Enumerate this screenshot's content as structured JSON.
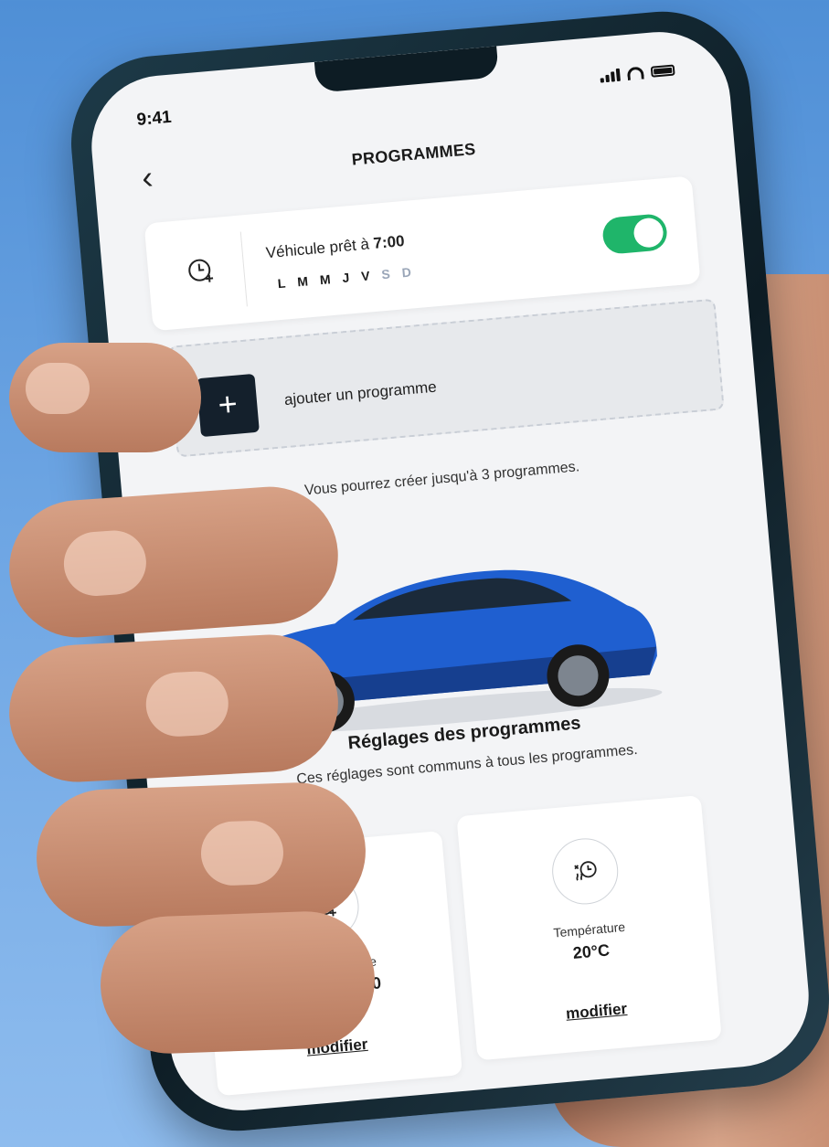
{
  "status_bar": {
    "time": "9:41"
  },
  "header": {
    "title": "PROGRAMMES",
    "back_icon": "chevron-left-icon"
  },
  "schedule": {
    "text": "Véhicule prêt à",
    "time": "7:00",
    "days": [
      {
        "label": "L",
        "active": true
      },
      {
        "label": "M",
        "active": true
      },
      {
        "label": "M",
        "active": true
      },
      {
        "label": "J",
        "active": true
      },
      {
        "label": "V",
        "active": true
      },
      {
        "label": "S",
        "active": false
      },
      {
        "label": "D",
        "active": false
      }
    ],
    "enabled": true
  },
  "add_program": {
    "label": "ajouter un programme"
  },
  "limit_note": "Vous pourrez créer jusqu'à 3 programmes.",
  "settings": {
    "title": "Réglages des programmes",
    "subtitle": "Ces réglages sont communs à tous les programmes."
  },
  "tiles": {
    "charge": {
      "label": "Charge planifiée",
      "value": "20:00 - 08:30",
      "link": "modifier"
    },
    "temperature": {
      "label": "Température",
      "value": "20°C",
      "link": "modifier"
    }
  },
  "colors": {
    "toggle_on": "#1fb56a",
    "add_button": "#14202c",
    "car": "#1f5fd0"
  }
}
